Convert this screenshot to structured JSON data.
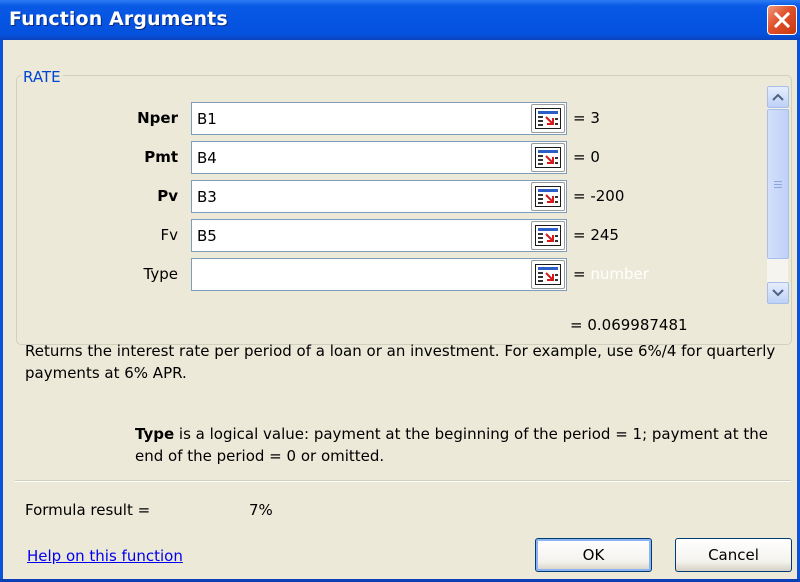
{
  "window": {
    "title": "Function Arguments",
    "close_icon": "close-icon"
  },
  "function": {
    "name": "RATE",
    "args": [
      {
        "label": "Nper",
        "bold": true,
        "value": "B1",
        "result": "= 3"
      },
      {
        "label": "Pmt",
        "bold": true,
        "value": "B4",
        "result": "= 0"
      },
      {
        "label": "Pv",
        "bold": true,
        "value": "B3",
        "result": "= -200"
      },
      {
        "label": "Fv",
        "bold": false,
        "value": "B5",
        "result": "= 245"
      },
      {
        "label": "Type",
        "bold": false,
        "value": "",
        "result": "=",
        "hint": "number"
      }
    ],
    "overall_result": "= 0.069987481",
    "description": "Returns the interest rate per period of a loan or an investment. For example, use 6%/4 for quarterly payments at 6% APR.",
    "arg_help_name": "Type",
    "arg_help_text": " is a logical value: payment at the beginning of the period = 1; payment at the end of the period = 0 or omitted."
  },
  "footer": {
    "formula_result_label": "Formula result =",
    "formula_result_value": "7%",
    "help_link": "Help on this function",
    "ok_label": "OK",
    "cancel_label": "Cancel"
  },
  "colors": {
    "title_blue": "#0a52d8",
    "dialog_bg": "#ece9d8",
    "legend_blue": "#0046d5",
    "close_red": "#e0502a"
  }
}
